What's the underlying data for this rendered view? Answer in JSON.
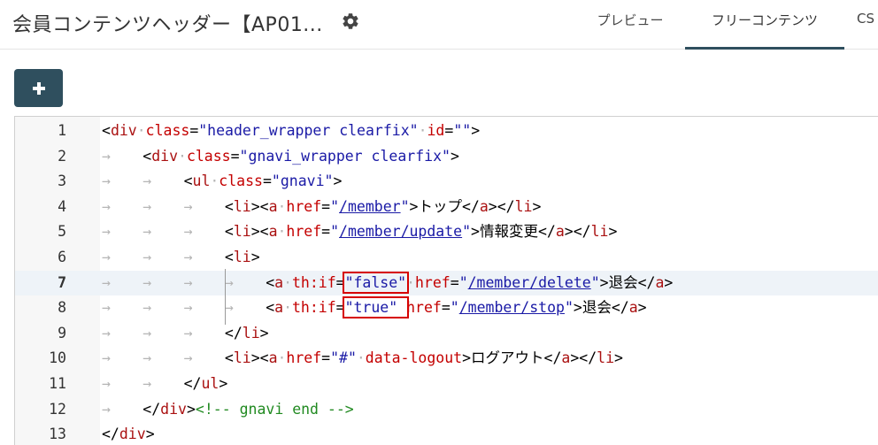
{
  "header": {
    "title": "会員コンテンツヘッダー【AP01...",
    "tabs": [
      "プレビュー",
      "フリーコンテンツ",
      "CS"
    ]
  },
  "toolbar": {
    "add_label": "+"
  },
  "editor": {
    "active_line": 7,
    "lines": [
      {
        "n": "1",
        "indent": 0,
        "tokens": [
          [
            "tag",
            "<"
          ],
          [
            "name",
            "div"
          ],
          [
            "ws",
            " "
          ],
          [
            "attr",
            "class"
          ],
          [
            "tag",
            "="
          ],
          [
            "str",
            "\"header_wrapper clearfix\""
          ],
          [
            "ws",
            " "
          ],
          [
            "attr",
            "id"
          ],
          [
            "tag",
            "="
          ],
          [
            "str",
            "\"\""
          ],
          [
            "tag",
            ">"
          ]
        ]
      },
      {
        "n": "2",
        "indent": 1,
        "tokens": [
          [
            "tag",
            "<"
          ],
          [
            "name",
            "div"
          ],
          [
            "ws",
            " "
          ],
          [
            "attr",
            "class"
          ],
          [
            "tag",
            "="
          ],
          [
            "str",
            "\"gnavi_wrapper clearfix\""
          ],
          [
            "tag",
            ">"
          ]
        ]
      },
      {
        "n": "3",
        "indent": 2,
        "tokens": [
          [
            "tag",
            "<"
          ],
          [
            "name",
            "ul"
          ],
          [
            "ws",
            " "
          ],
          [
            "attr",
            "class"
          ],
          [
            "tag",
            "="
          ],
          [
            "str",
            "\"gnavi\""
          ],
          [
            "tag",
            ">"
          ]
        ]
      },
      {
        "n": "4",
        "indent": 3,
        "tokens": [
          [
            "tag",
            "<"
          ],
          [
            "name",
            "li"
          ],
          [
            "tag",
            "><"
          ],
          [
            "name",
            "a"
          ],
          [
            "ws",
            " "
          ],
          [
            "attr",
            "href"
          ],
          [
            "tag",
            "="
          ],
          [
            "str",
            "\""
          ],
          [
            "link",
            "/member"
          ],
          [
            "str",
            "\""
          ],
          [
            "tag",
            ">"
          ],
          [
            "txt",
            "トップ"
          ],
          [
            "tag",
            "</"
          ],
          [
            "name",
            "a"
          ],
          [
            "tag",
            "></"
          ],
          [
            "name",
            "li"
          ],
          [
            "tag",
            ">"
          ]
        ]
      },
      {
        "n": "5",
        "indent": 3,
        "tokens": [
          [
            "tag",
            "<"
          ],
          [
            "name",
            "li"
          ],
          [
            "tag",
            "><"
          ],
          [
            "name",
            "a"
          ],
          [
            "ws",
            " "
          ],
          [
            "attr",
            "href"
          ],
          [
            "tag",
            "="
          ],
          [
            "str",
            "\""
          ],
          [
            "link",
            "/member/update"
          ],
          [
            "str",
            "\""
          ],
          [
            "tag",
            ">"
          ],
          [
            "txt",
            "情報変更"
          ],
          [
            "tag",
            "</"
          ],
          [
            "name",
            "a"
          ],
          [
            "tag",
            "></"
          ],
          [
            "name",
            "li"
          ],
          [
            "tag",
            ">"
          ]
        ]
      },
      {
        "n": "6",
        "indent": 3,
        "tokens": [
          [
            "tag",
            "<"
          ],
          [
            "name",
            "li"
          ],
          [
            "tag",
            ">"
          ]
        ]
      },
      {
        "n": "7",
        "indent": 4,
        "tokens": [
          [
            "tag",
            "<"
          ],
          [
            "name",
            "a"
          ],
          [
            "ws",
            " "
          ],
          [
            "attr",
            "th:if"
          ],
          [
            "tag",
            "="
          ],
          [
            "hl",
            "\"false\""
          ],
          [
            "ws",
            " "
          ],
          [
            "attr",
            "href"
          ],
          [
            "tag",
            "="
          ],
          [
            "str",
            "\""
          ],
          [
            "link",
            "/member/delete"
          ],
          [
            "str",
            "\""
          ],
          [
            "tag",
            ">"
          ],
          [
            "txt",
            "退会"
          ],
          [
            "tag",
            "</"
          ],
          [
            "name",
            "a"
          ],
          [
            "tag",
            ">"
          ]
        ]
      },
      {
        "n": "8",
        "indent": 4,
        "tokens": [
          [
            "tag",
            "<"
          ],
          [
            "name",
            "a"
          ],
          [
            "ws",
            " "
          ],
          [
            "attr",
            "th:if"
          ],
          [
            "tag",
            "="
          ],
          [
            "hl",
            "\"true\" "
          ],
          [
            "attr",
            "href"
          ],
          [
            "tag",
            "="
          ],
          [
            "str",
            "\""
          ],
          [
            "link",
            "/member/stop"
          ],
          [
            "str",
            "\""
          ],
          [
            "tag",
            ">"
          ],
          [
            "txt",
            "退会"
          ],
          [
            "tag",
            "</"
          ],
          [
            "name",
            "a"
          ],
          [
            "tag",
            ">"
          ]
        ]
      },
      {
        "n": "9",
        "indent": 3,
        "tokens": [
          [
            "tag",
            "</"
          ],
          [
            "name",
            "li"
          ],
          [
            "tag",
            ">"
          ]
        ]
      },
      {
        "n": "10",
        "indent": 3,
        "tokens": [
          [
            "tag",
            "<"
          ],
          [
            "name",
            "li"
          ],
          [
            "tag",
            "><"
          ],
          [
            "name",
            "a"
          ],
          [
            "ws",
            " "
          ],
          [
            "attr",
            "href"
          ],
          [
            "tag",
            "="
          ],
          [
            "str",
            "\"#\""
          ],
          [
            "ws",
            " "
          ],
          [
            "attr",
            "data-logout"
          ],
          [
            "tag",
            ">"
          ],
          [
            "txt",
            "ログアウト"
          ],
          [
            "tag",
            "</"
          ],
          [
            "name",
            "a"
          ],
          [
            "tag",
            "></"
          ],
          [
            "name",
            "li"
          ],
          [
            "tag",
            ">"
          ]
        ]
      },
      {
        "n": "11",
        "indent": 2,
        "tokens": [
          [
            "tag",
            "</"
          ],
          [
            "name",
            "ul"
          ],
          [
            "tag",
            ">"
          ]
        ]
      },
      {
        "n": "12",
        "indent": 1,
        "tokens": [
          [
            "tag",
            "</"
          ],
          [
            "name",
            "div"
          ],
          [
            "tag",
            ">"
          ],
          [
            "cmt",
            "<!-- gnavi end -->"
          ]
        ]
      },
      {
        "n": "13",
        "indent": 0,
        "tokens": [
          [
            "tag",
            "</"
          ],
          [
            "name",
            "div"
          ],
          [
            "tag",
            ">"
          ]
        ]
      }
    ]
  },
  "colors": {
    "accent": "#2f4f5e",
    "highlight_box": "#d60000",
    "active_line_bg": "#eef3f8"
  },
  "icons": {
    "settings": "gear-icon",
    "add": "plus-icon"
  }
}
